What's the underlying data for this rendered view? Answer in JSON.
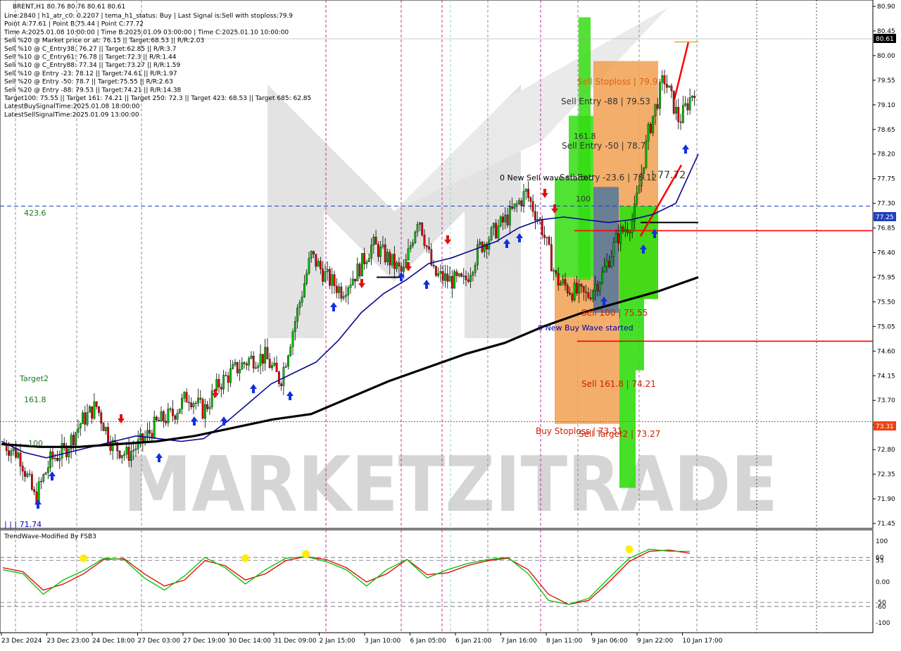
{
  "header": {
    "symbol_line": "BRENT,H1  80.76 80.76 80.61 80.61",
    "info_lines": [
      "Line:2840 | h1_atr_c0: 0.2207 | tema_h1_status: Buy | Last Signal is:Sell with stoploss:79.9",
      "Point A:77.61 | Point B:75.44 | Point C:77.72",
      "Time A:2025.01.08 10:00:00 | Time B:2025.01.09 03:00:00 | Time C:2025.01.10 10:00:00",
      "Sell %20 @ Market price or at: 76.15 || Target:68.53 || R/R:2.03",
      "Sell %10 @ C_Entry38: 76.27 || Target:62.85 || R/R:3.7",
      "Sell %10 @ C_Entry61: 76.78 || Target:72.3 || R/R:1.44",
      "Sell %10 @ C_Entry88: 77.34 || Target:73.27 || R/R:1.59",
      "Sell %10 @ Entry -23: 78.12 || Target:74.61 || R/R:1.97",
      "Sell %20 @ Entry -50: 78.7 || Target:75.55 || R/R:2.63",
      "Sell %20 @ Entry -88: 79.53 || Target:74.21 || R/R:14.38",
      "Target100: 75.55 || Target 161: 74.21 || Target 250: 72.3 || Target 423: 68.53 || Target 685: 62.85",
      "LatestBuySignalTime:2025.01.08 18:00:00",
      "LatestSellSignalTime:2025.01.09 13:00:00"
    ]
  },
  "price_axis": {
    "ticks": [
      "80.90",
      "80.45",
      "80.00",
      "79.55",
      "79.10",
      "78.65",
      "78.20",
      "77.75",
      "77.30",
      "76.85",
      "76.40",
      "75.95",
      "75.50",
      "75.05",
      "74.60",
      "74.15",
      "73.70",
      "73.25",
      "72.80",
      "72.35",
      "71.90",
      "71.45"
    ],
    "current_price": "80.61",
    "level_blue": "77.25",
    "level_red": "73.31"
  },
  "time_axis": {
    "labels": [
      "23 Dec 2024",
      "23 Dec 23:00",
      "24 Dec 18:00",
      "27 Dec 03:00",
      "27 Dec 19:00",
      "30 Dec 14:00",
      "31 Dec 09:00",
      "2 Jan 15:00",
      "3 Jan 10:00",
      "6 Jan 05:00",
      "6 Jan 21:00",
      "7 Jan 16:00",
      "8 Jan 11:00",
      "9 Jan 06:00",
      "9 Jan 22:00",
      "10 Jan 17:00"
    ]
  },
  "annotations": {
    "lbl_423": "423.6",
    "lbl_target2": "Target2",
    "lbl_1618": "161.8",
    "lbl_100": "100",
    "lbl_low": "| | | 71.74",
    "sell_stoploss": "Sell Stoploss | 79.9",
    "sell_entry_88": "Sell Entry -88 | 79.53",
    "sell_entry_50": "Sell Entry -50 | 78.7",
    "sell_entry_23": "Sell Entry -23.6 | 78.12",
    "point_c": "| 77.72",
    "new_sell_wave": "0 New Sell wave started",
    "new_buy_wave": "0 New Buy Wave started",
    "sell_100": "Sell 100 | 75.55",
    "sell_1618": "Sell 161.8 | 74.21",
    "buy_stoploss": "Buy Stoploss | 73.31",
    "sell_target2": "Sell Target2 | 73.27",
    "box_1618": "161.8",
    "box_100": "100",
    "watermark": "MARKETZITRADE"
  },
  "oscillator": {
    "title": "TrendWave-Modified By FSB3",
    "ticks": [
      "100",
      "60",
      "53",
      "0.00",
      "-50",
      "-60",
      "-100"
    ]
  },
  "colors": {
    "bull_line": "#00c000",
    "bear_line": "#e00000",
    "ema_short": "#0a0a90",
    "ema_long": "#000000",
    "sell_zone": "#f0a050",
    "buy_zone": "#33dd11",
    "level_blue": "#1f3fbf",
    "level_red": "#ff0000"
  },
  "chart_data": {
    "type": "candlestick",
    "title": "BRENT,H1",
    "x": [
      "23 Dec 2024",
      "23 Dec 23:00",
      "24 Dec 18:00",
      "27 Dec 03:00",
      "27 Dec 19:00",
      "30 Dec 14:00",
      "31 Dec 09:00",
      "2 Jan 15:00",
      "3 Jan 10:00",
      "6 Jan 05:00",
      "6 Jan 21:00",
      "7 Jan 16:00",
      "8 Jan 11:00",
      "9 Jan 06:00",
      "9 Jan 22:00",
      "10 Jan 17:00"
    ],
    "price_path": [
      72.9,
      72.7,
      71.9,
      72.6,
      72.8,
      73.3,
      73.6,
      72.9,
      72.7,
      72.95,
      73.3,
      73.45,
      73.8,
      73.5,
      74.0,
      74.25,
      74.45,
      74.5,
      74.05,
      75.2,
      76.35,
      75.95,
      75.7,
      76.05,
      76.55,
      76.3,
      76.0,
      77.1,
      76.0,
      75.9,
      75.85,
      76.5,
      76.8,
      77.1,
      77.5,
      76.9,
      75.9,
      75.7,
      75.6,
      76.0,
      76.7,
      77.0,
      78.6,
      79.6,
      78.8,
      79.4
    ],
    "price_range": [
      71.45,
      80.9
    ],
    "ema_short": [
      72.95,
      72.75,
      72.65,
      72.75,
      72.85,
      72.95,
      73.05,
      73.0,
      72.95,
      73.0,
      73.3,
      73.65,
      74.0,
      74.2,
      74.4,
      74.8,
      75.3,
      75.65,
      75.9,
      76.2,
      76.3,
      76.45,
      76.6,
      76.85,
      77.0,
      77.05,
      77.0,
      76.95,
      77.0,
      77.1,
      77.3,
      78.2
    ],
    "ema_long": [
      72.9,
      72.85,
      72.85,
      72.9,
      72.95,
      73.05,
      73.2,
      73.35,
      73.45,
      73.75,
      74.05,
      74.3,
      74.55,
      74.75,
      75.05,
      75.3,
      75.5,
      75.7,
      75.95
    ],
    "oscillator_range": [
      -100,
      100
    ],
    "oscillator_green": [
      30,
      20,
      -30,
      5,
      28,
      58,
      55,
      10,
      -20,
      15,
      60,
      35,
      -5,
      30,
      58,
      62,
      50,
      30,
      -10,
      30,
      55,
      10,
      30,
      45,
      55,
      60,
      20,
      -45,
      -55,
      -40,
      10,
      58,
      80,
      75,
      75
    ],
    "oscillator_red": [
      35,
      25,
      -20,
      -5,
      20,
      55,
      57,
      20,
      -10,
      5,
      52,
      40,
      5,
      20,
      52,
      62,
      55,
      35,
      0,
      20,
      55,
      18,
      22,
      40,
      52,
      58,
      30,
      -30,
      -55,
      -45,
      0,
      50,
      75,
      78,
      70
    ],
    "yellow_dots": [
      [
        4,
        58
      ],
      [
        12,
        58
      ],
      [
        15,
        68
      ],
      [
        31,
        80
      ]
    ],
    "levels": {
      "blue_dashed": 77.25,
      "red_dotted": 73.31,
      "red_solid_a": 76.8,
      "red_solid_b": 74.78,
      "black_short": 76.95
    },
    "zones": [
      {
        "label": "sell stoploss zone",
        "color": "orange",
        "y0": 75.55,
        "y1": 79.9
      },
      {
        "label": "sell target zone",
        "color": "orange",
        "y0": 73.27,
        "y1": 76.15
      },
      {
        "label": "green channel",
        "color": "green",
        "y0": 72.1,
        "y1": 80.7
      }
    ]
  }
}
